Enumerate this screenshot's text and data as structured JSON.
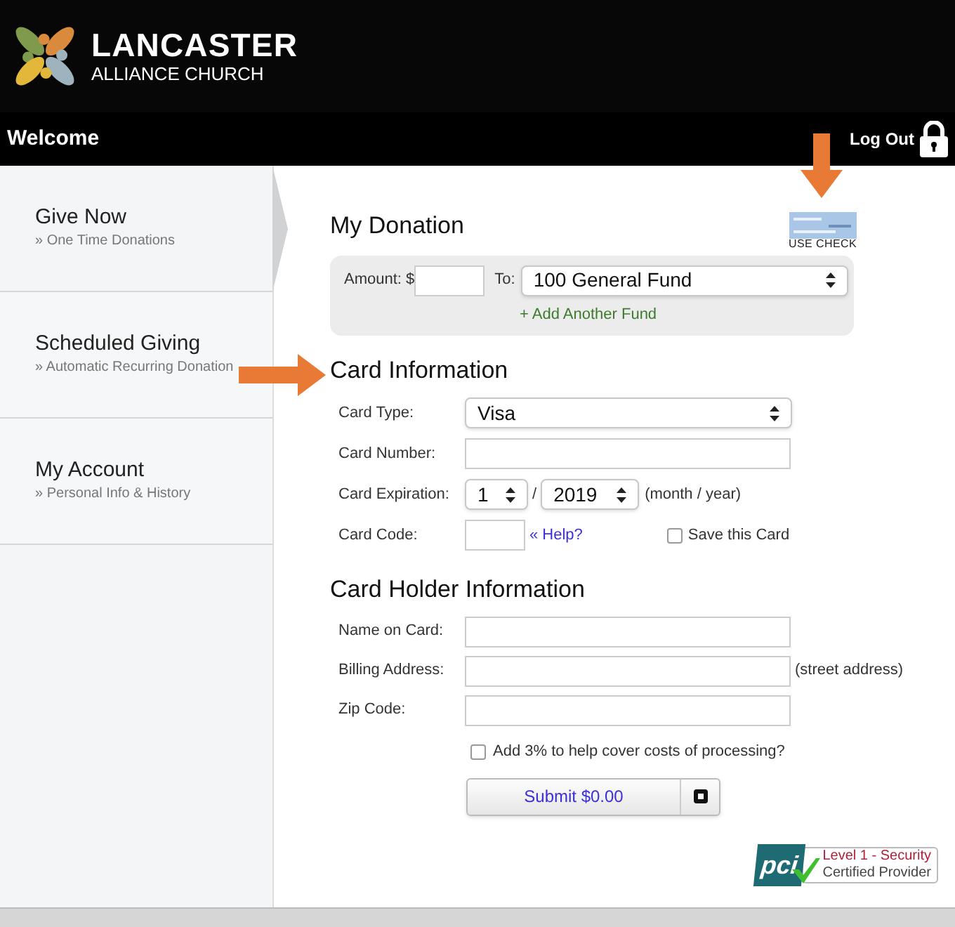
{
  "header": {
    "logo_title": "LANCASTER",
    "logo_subtitle": "ALLIANCE CHURCH"
  },
  "top_bar": {
    "title": "Welcome",
    "logout": "Log Out"
  },
  "sidebar": {
    "items": [
      {
        "title": "Give Now",
        "subtitle": "» One Time Donations",
        "selected": true
      },
      {
        "title": "Scheduled Giving",
        "subtitle": "» Automatic Recurring Donation",
        "selected": false
      },
      {
        "title": "My Account",
        "subtitle": "» Personal Info & History",
        "selected": false
      }
    ]
  },
  "donation": {
    "title": "My Donation",
    "use_check": "USE CHECK",
    "amount_label": "Amount: $",
    "to_label": "To:",
    "fund": "100 General Fund",
    "add_fund": "+ Add Another Fund"
  },
  "card_info": {
    "title": "Card Information",
    "card_type_label": "Card Type:",
    "card_type": "Visa",
    "card_number_label": "Card Number:",
    "expiration_label": "Card Expiration:",
    "month": "1",
    "separator": "/",
    "year": "2019",
    "expiration_hint": "(month / year)",
    "code_label": "Card Code:",
    "help_link": "« Help?",
    "save_card": {
      "label": "Save this Card",
      "checked": false
    }
  },
  "card_holder": {
    "title": "Card Holder Information",
    "fields": [
      {
        "label": "Name on Card:"
      },
      {
        "label": "Billing Address:",
        "hint": "(street address)"
      },
      {
        "label": "Zip Code:"
      }
    ]
  },
  "processing_fee": {
    "label": "Add 3% to help cover costs of processing?",
    "checked": false
  },
  "submit": "Submit $0.00",
  "badge": {
    "logo": "pci",
    "line_1": "Level 1 - Security",
    "line_2": "Certified Provider"
  }
}
